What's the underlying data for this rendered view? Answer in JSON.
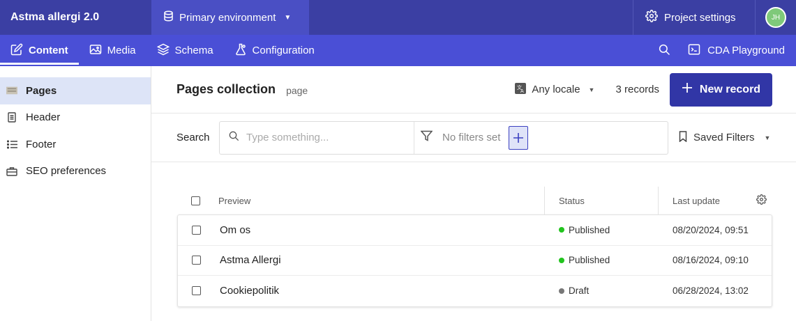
{
  "app": {
    "title": "Astma allergi 2.0"
  },
  "environment": {
    "label": "Primary environment"
  },
  "project_settings": {
    "label": "Project settings"
  },
  "user": {
    "initials": "JH"
  },
  "nav": {
    "items": [
      {
        "label": "Content",
        "icon": "edit-icon",
        "active": true
      },
      {
        "label": "Media",
        "icon": "image-icon"
      },
      {
        "label": "Schema",
        "icon": "layers-icon"
      },
      {
        "label": "Configuration",
        "icon": "flask-icon"
      }
    ],
    "cda_label": "CDA Playground"
  },
  "sidebar": {
    "items": [
      {
        "label": "Pages",
        "icon": "pages-icon",
        "active": true
      },
      {
        "label": "Header",
        "icon": "document-icon"
      },
      {
        "label": "Footer",
        "icon": "list-icon"
      },
      {
        "label": "SEO preferences",
        "icon": "toolbox-icon"
      }
    ]
  },
  "main": {
    "title": "Pages collection",
    "model_id": "page",
    "locale_label": "Any locale",
    "records_count": "3 records",
    "new_record_label": "New record"
  },
  "search": {
    "label": "Search",
    "placeholder": "Type something...",
    "filters_text": "No filters set",
    "saved_filters_label": "Saved Filters"
  },
  "table": {
    "columns": {
      "preview": "Preview",
      "status": "Status",
      "last_update": "Last update"
    },
    "rows": [
      {
        "preview": "Om os",
        "status": "Published",
        "status_color": "#22c41e",
        "last_update": "08/20/2024, 09:51"
      },
      {
        "preview": "Astma Allergi",
        "status": "Published",
        "status_color": "#22c41e",
        "last_update": "08/16/2024, 09:10"
      },
      {
        "preview": "Cookiepolitik",
        "status": "Draft",
        "status_color": "#777777",
        "last_update": "06/28/2024, 13:02"
      }
    ]
  },
  "colors": {
    "topbar": "#3b3fa3",
    "environment": "#4a4fc4",
    "navbar": "#4a4fd6",
    "primary_button": "#3136a6",
    "sidebar_active": "#dde4f7"
  }
}
